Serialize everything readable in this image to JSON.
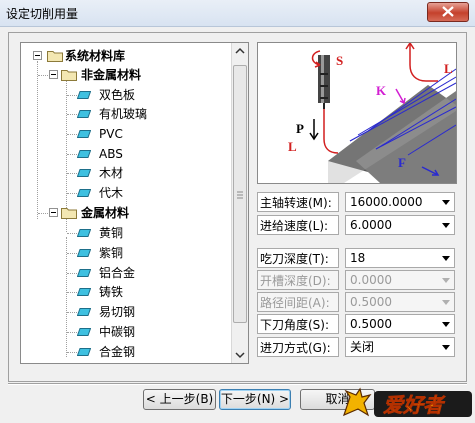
{
  "window": {
    "title": "设定切削用量"
  },
  "tree": {
    "root": "系统材料库",
    "groups": [
      {
        "label": "非金属材料",
        "items": [
          "双色板",
          "有机玻璃",
          "PVC",
          "ABS",
          "木材",
          "代木"
        ]
      },
      {
        "label": "金属材料",
        "items": [
          "黄铜",
          "紫铜",
          "铝合金",
          "铸铁",
          "易切钢",
          "中碳钢",
          "合金钢"
        ]
      }
    ]
  },
  "preview": {
    "labels": {
      "s": "S",
      "l_top": "L",
      "k": "K",
      "p": "P",
      "l_bottom": "L",
      "f": "F"
    }
  },
  "params": [
    {
      "label": "主轴转速(M):",
      "value": "16000.0000",
      "enabled": true
    },
    {
      "label": "进给速度(L):",
      "value": "6.0000",
      "enabled": true
    },
    {
      "label": "吃刀深度(T):",
      "value": "18",
      "enabled": true
    },
    {
      "label": "开槽深度(D):",
      "value": "0.0000",
      "enabled": false
    },
    {
      "label": "路径间距(A):",
      "value": "0.5000",
      "enabled": false
    },
    {
      "label": "下刀角度(S):",
      "value": "0.5000",
      "enabled": true
    },
    {
      "label": "进刀方式(G):",
      "value": "关闭",
      "enabled": true
    }
  ],
  "buttons": {
    "back": "< 上一步(B)",
    "next": "下一步(N) >",
    "cancel": "取消"
  },
  "logo_text": "爱好者"
}
